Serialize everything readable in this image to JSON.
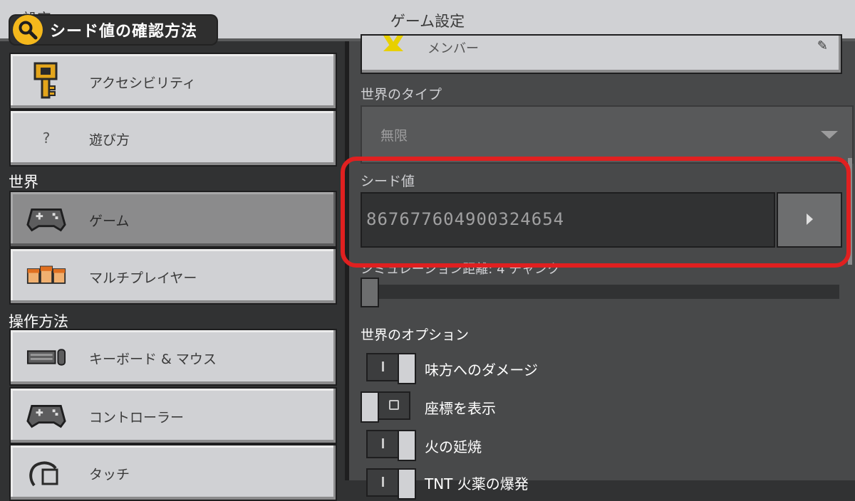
{
  "header": {
    "left_title": "設定",
    "center_title": "ゲーム設定"
  },
  "overlay": {
    "label": "シード値の確認方法",
    "icon": "magnifier-icon"
  },
  "sidebar": {
    "items_top": [
      {
        "label": "アクセシビリティ",
        "icon": "key-icon"
      },
      {
        "label": "遊び方",
        "icon": "question-icon"
      }
    ],
    "section_world": "世界",
    "items_world": [
      {
        "label": "ゲーム",
        "icon": "gamepad-icon",
        "selected": true
      },
      {
        "label": "マルチプレイヤー",
        "icon": "players-icon"
      }
    ],
    "section_controls": "操作方法",
    "items_controls": [
      {
        "label": "キーボード & マウス",
        "icon": "keyboard-icon"
      },
      {
        "label": "コントローラー",
        "icon": "controller-icon"
      },
      {
        "label": "タッチ",
        "icon": "touch-icon"
      }
    ]
  },
  "main": {
    "member_label": "メンバー",
    "world_type_label": "世界のタイプ",
    "world_type_value": "無限",
    "seed_label": "シード値",
    "seed_value": "867677604900324654",
    "sim_label": "シミュレーション距離: 4 チャンク",
    "sim_level": 0,
    "options_title": "世界のオプション",
    "options": [
      {
        "label": "味方へのダメージ",
        "on": true
      },
      {
        "label": "座標を表示",
        "on": false
      },
      {
        "label": "火の延焼",
        "on": true
      },
      {
        "label": "TNT 火薬の爆発",
        "on": true
      }
    ]
  },
  "colors": {
    "highlight": "#e02020",
    "badge_circle": "#f4b81c",
    "panel_bg": "#48494a",
    "button_bg": "#d0d1d4"
  }
}
